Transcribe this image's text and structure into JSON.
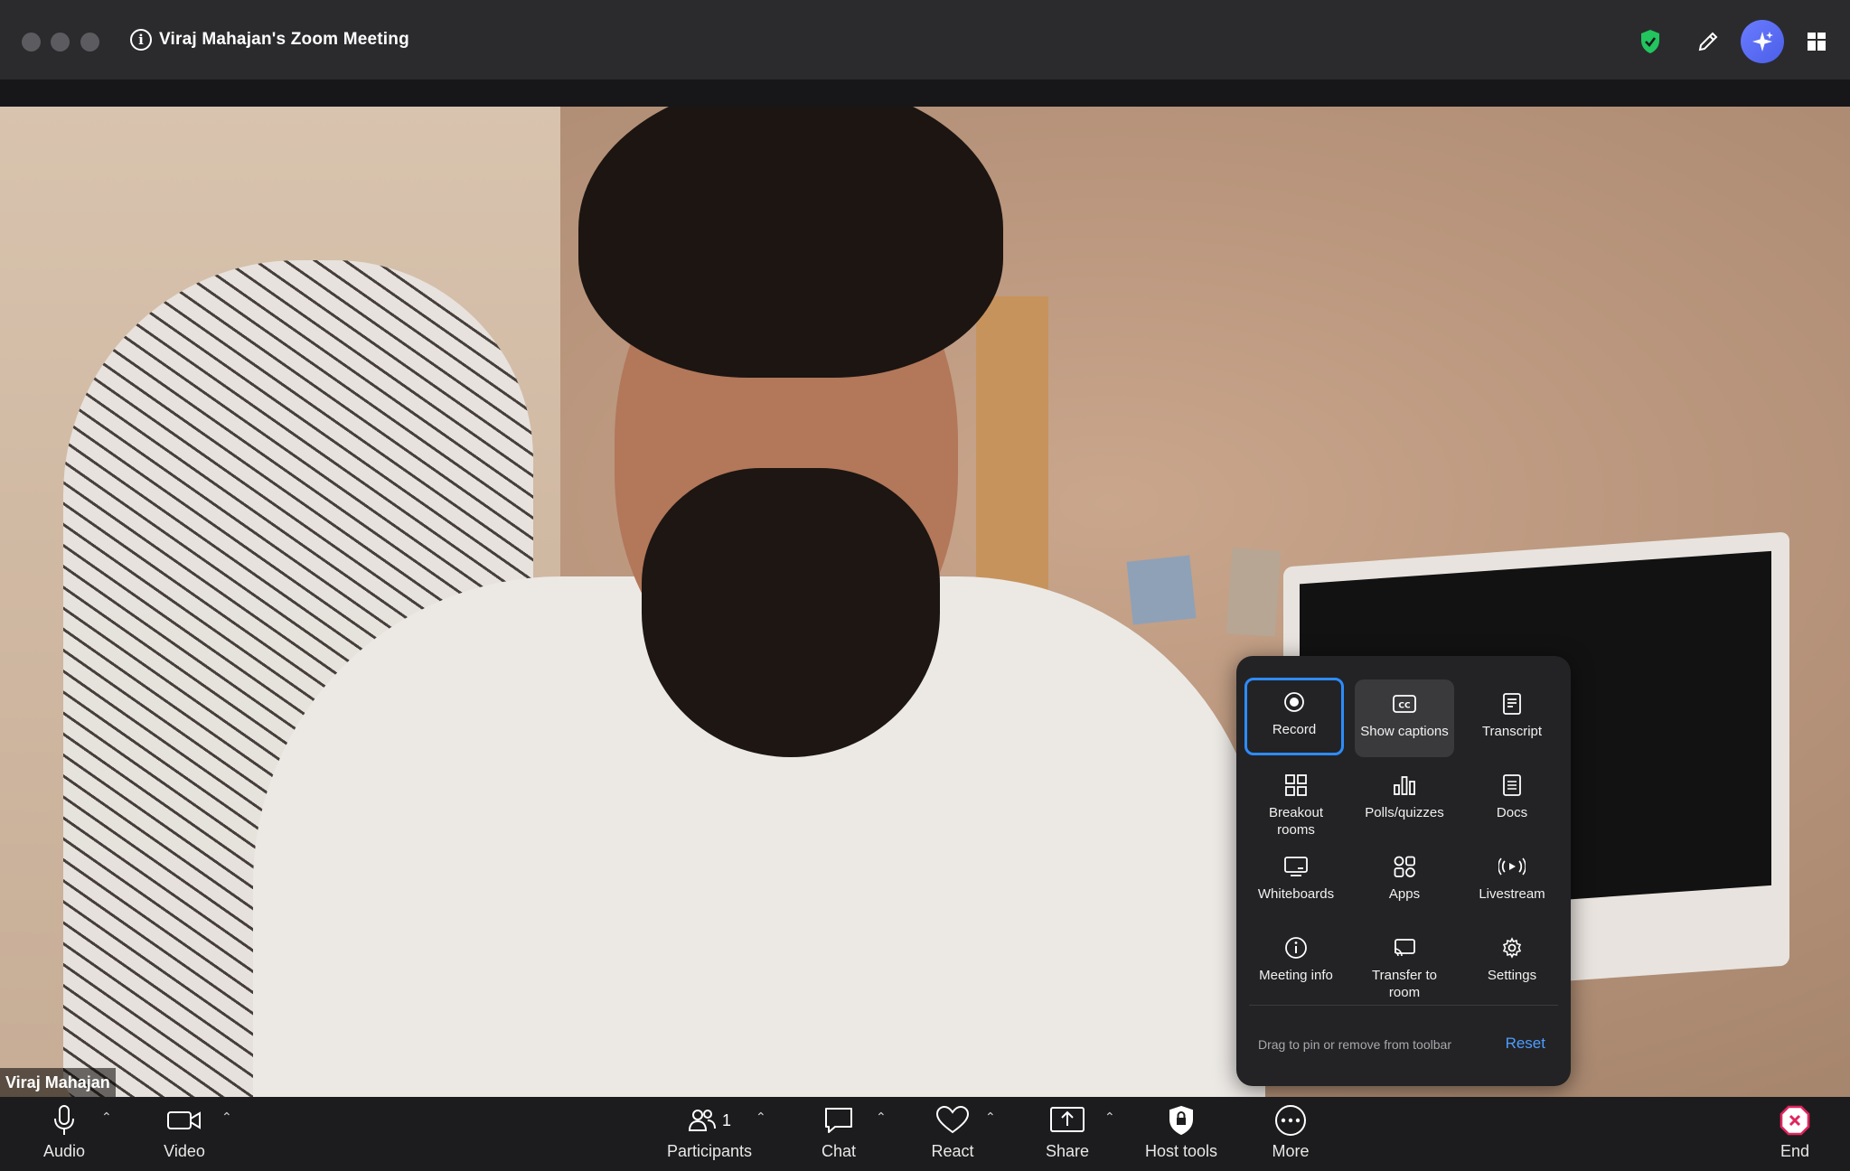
{
  "window": {
    "title": "Viraj Mahajan's Zoom Meeting",
    "info_icon": "info-icon",
    "right_icons": [
      "shield-check-icon",
      "pencil-icon",
      "ai-companion-sparkle-icon",
      "view-grid-icon"
    ],
    "colors": {
      "titlebar": "#2b2b2e",
      "shield": "#22c55e",
      "ai_button": "#5a6ff0"
    }
  },
  "video": {
    "participant_name": "Viraj Mahajan"
  },
  "more_menu": {
    "items": [
      {
        "label": "Record",
        "icon": "record-icon",
        "state": "focused"
      },
      {
        "label": "Show captions",
        "icon": "closed-captions-icon",
        "state": "hover"
      },
      {
        "label": "Transcript",
        "icon": "transcript-icon",
        "state": "normal"
      },
      {
        "label": "Breakout rooms",
        "icon": "breakout-rooms-icon",
        "state": "normal"
      },
      {
        "label": "Polls/quizzes",
        "icon": "polls-icon",
        "state": "normal"
      },
      {
        "label": "Docs",
        "icon": "docs-icon",
        "state": "normal"
      },
      {
        "label": "Whiteboards",
        "icon": "whiteboard-icon",
        "state": "normal"
      },
      {
        "label": "Apps",
        "icon": "apps-icon",
        "state": "normal"
      },
      {
        "label": "Livestream",
        "icon": "livestream-icon",
        "state": "normal"
      },
      {
        "label": "Meeting info",
        "icon": "info-icon",
        "state": "normal"
      },
      {
        "label": "Transfer to room",
        "icon": "transfer-room-icon",
        "state": "normal"
      },
      {
        "label": "Settings",
        "icon": "gear-icon",
        "state": "normal"
      }
    ],
    "footer_text": "Drag to pin or remove from toolbar",
    "reset_label": "Reset",
    "accent": "#2d8cff"
  },
  "toolbar": {
    "audio_label": "Audio",
    "video_label": "Video",
    "participants_label": "Participants",
    "participants_count": "1",
    "chat_label": "Chat",
    "react_label": "React",
    "share_label": "Share",
    "host_tools_label": "Host tools",
    "more_label": "More",
    "end_label": "End",
    "end_color": "#e0245e"
  }
}
